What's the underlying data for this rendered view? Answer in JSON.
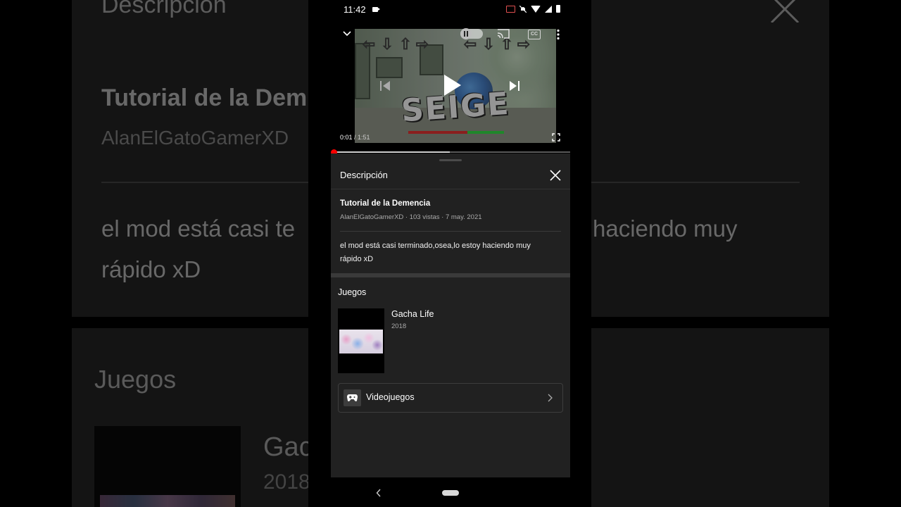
{
  "status_bar": {
    "time": "11:42"
  },
  "player": {
    "current_time": "0:01",
    "separator": " / ",
    "duration": "1:51",
    "progress_fraction": 0.009,
    "buffered_fraction": 0.49,
    "cc_label": "CC",
    "video_logo_text": "SEIGE"
  },
  "description_panel": {
    "header": "Descripción",
    "video_title": "Tutorial de la Demencia",
    "meta": "AlanElGatoGamerXD · 103 vistas · 7 may. 2021",
    "channel": "AlanElGatoGamerXD",
    "description_line1": "el mod está casi terminado,osea,lo estoy haciendo muy",
    "description_line2": "rápido xD",
    "games_section_title": "Juegos",
    "game": {
      "name": "Gacha Life",
      "year": "2018"
    },
    "category_label": "Videojuegos"
  },
  "background_mirror": {
    "title": "Descripción",
    "video_title": "Tutorial de la Dem",
    "channel": "AlanElGatoGamerXD",
    "description_line1_left": "el mod está casi te",
    "description_line1_right": "haciendo muy",
    "description_line2": "rápido xD",
    "games_title": "Juegos",
    "game_name": "Gac",
    "game_year": "2018"
  },
  "colors": {
    "accent_red": "#ff0000",
    "sheet_background": "#212121",
    "page_background": "#000000"
  },
  "icons": [
    "collapse-chevron-icon",
    "pause-toggle-icon",
    "cast-icon",
    "cc-icon",
    "more-vert-icon",
    "previous-icon",
    "play-icon",
    "next-icon",
    "fullscreen-icon",
    "close-icon",
    "gamepad-icon",
    "chevron-right-icon",
    "nav-back-icon",
    "nav-home-pill"
  ]
}
